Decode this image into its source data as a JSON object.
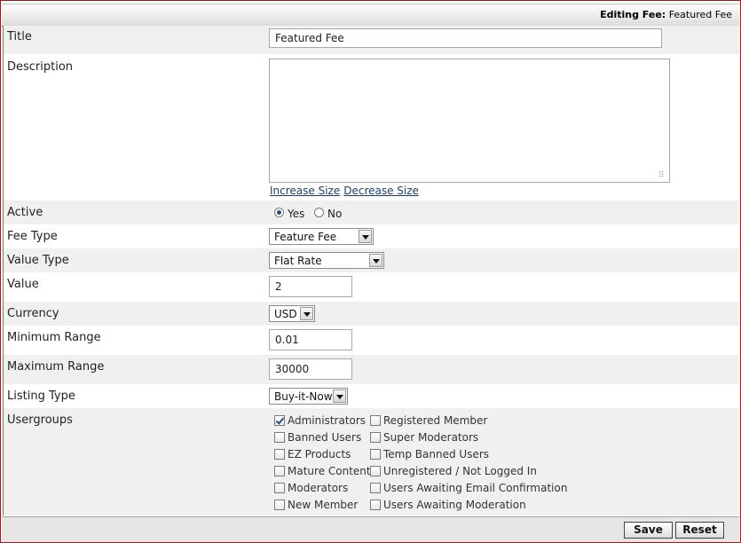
{
  "header": {
    "editing_prefix": "Editing Fee:",
    "editing_name": "Featured Fee"
  },
  "labels": {
    "title": "Title",
    "description": "Description",
    "active": "Active",
    "fee_type": "Fee Type",
    "value_type": "Value Type",
    "value": "Value",
    "currency": "Currency",
    "minimum_range": "Minimum Range",
    "maximum_range": "Maximum Range",
    "listing_type": "Listing Type",
    "usergroups": "Usergroups"
  },
  "values": {
    "title": "Featured Fee",
    "description": "",
    "active_yes": "Yes",
    "active_no": "No",
    "active_selected": "Yes",
    "fee_type": "Feature Fee",
    "value_type": "Flat Rate",
    "value": "2",
    "currency": "USD",
    "minimum_range": "0.01",
    "maximum_range": "30000",
    "listing_type": "Buy-it-Now"
  },
  "description_links": {
    "increase": "Increase Size",
    "decrease": "Decrease Size"
  },
  "usergroups": [
    {
      "label": "Administrators",
      "checked": true
    },
    {
      "label": "Registered Member",
      "checked": false
    },
    {
      "label": "Banned Users",
      "checked": false
    },
    {
      "label": "Super Moderators",
      "checked": false
    },
    {
      "label": "EZ Products",
      "checked": false
    },
    {
      "label": "Temp Banned Users",
      "checked": false
    },
    {
      "label": "Mature Content",
      "checked": false
    },
    {
      "label": "Unregistered / Not Logged In",
      "checked": false
    },
    {
      "label": "Moderators",
      "checked": false
    },
    {
      "label": "Users Awaiting Email Confirmation",
      "checked": false
    },
    {
      "label": "New Member",
      "checked": false
    },
    {
      "label": "Users Awaiting Moderation",
      "checked": false
    }
  ],
  "buttons": {
    "save": "Save",
    "reset": "Reset"
  }
}
